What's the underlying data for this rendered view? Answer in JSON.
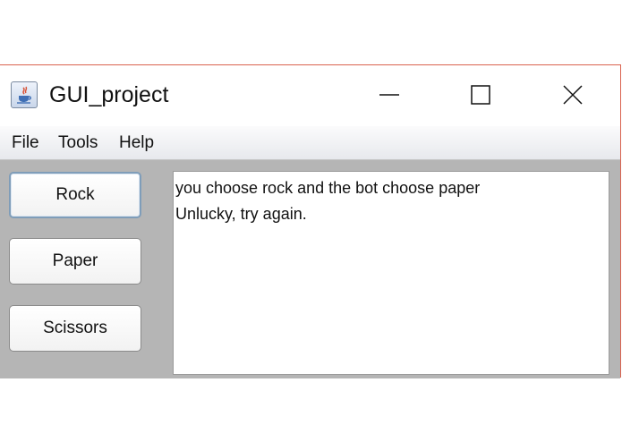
{
  "window": {
    "title": "GUI_project",
    "icon": "java-icon"
  },
  "menu": [
    {
      "label": "File"
    },
    {
      "label": "Tools"
    },
    {
      "label": "Help"
    }
  ],
  "buttons": {
    "rock": "Rock",
    "paper": "Paper",
    "scissors": "Scissors"
  },
  "output": {
    "lines": [
      "you choose rock and the bot choose paper",
      "Unlucky, try again."
    ]
  },
  "colors": {
    "window_border": "#d9634f",
    "content_bg": "#b5b5b5",
    "focus_border": "#7f9db9"
  }
}
